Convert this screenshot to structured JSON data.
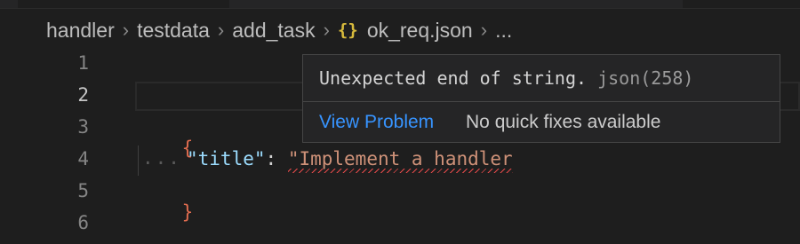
{
  "breadcrumb": {
    "items": [
      "handler",
      "testdata",
      "add_task"
    ],
    "file_icon": "{}",
    "file_name": "ok_req.json",
    "more": "..."
  },
  "editor": {
    "line_numbers": [
      "1",
      "2",
      "3",
      "4",
      "5",
      "6"
    ],
    "active_line": "2",
    "lines": {
      "open_brace": "{",
      "key": "\"title\"",
      "colon": ": ",
      "string": "\"Implement a handler",
      "close_brace": "}"
    }
  },
  "hover": {
    "message": "Unexpected end of string.",
    "source": "json(258)",
    "view_problem": "View Problem",
    "no_fixes": "No quick fixes available"
  },
  "colors": {
    "background": "#1e1e1e",
    "brace": "#e06c4f",
    "key": "#9cdcfe",
    "string": "#ce9178",
    "link": "#3794ff",
    "error": "#f14c4c",
    "json_icon": "#d7ba3c"
  },
  "icons": {
    "chevron": "chevron-right-icon",
    "file": "json-file-icon"
  }
}
